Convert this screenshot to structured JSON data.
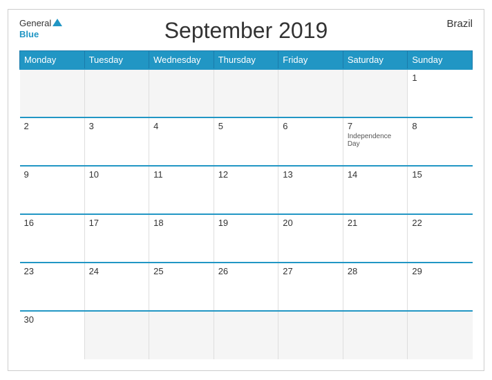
{
  "header": {
    "title": "September 2019",
    "country": "Brazil",
    "logo_general": "General",
    "logo_blue": "Blue"
  },
  "weekdays": [
    "Monday",
    "Tuesday",
    "Wednesday",
    "Thursday",
    "Friday",
    "Saturday",
    "Sunday"
  ],
  "weeks": [
    [
      {
        "day": "",
        "empty": true
      },
      {
        "day": "",
        "empty": true
      },
      {
        "day": "",
        "empty": true
      },
      {
        "day": "",
        "empty": true
      },
      {
        "day": "",
        "empty": true
      },
      {
        "day": "",
        "empty": true
      },
      {
        "day": "1",
        "empty": false
      }
    ],
    [
      {
        "day": "2",
        "empty": false
      },
      {
        "day": "3",
        "empty": false
      },
      {
        "day": "4",
        "empty": false
      },
      {
        "day": "5",
        "empty": false
      },
      {
        "day": "6",
        "empty": false
      },
      {
        "day": "7",
        "empty": false,
        "holiday": "Independence Day"
      },
      {
        "day": "8",
        "empty": false
      }
    ],
    [
      {
        "day": "9",
        "empty": false
      },
      {
        "day": "10",
        "empty": false
      },
      {
        "day": "11",
        "empty": false
      },
      {
        "day": "12",
        "empty": false
      },
      {
        "day": "13",
        "empty": false
      },
      {
        "day": "14",
        "empty": false
      },
      {
        "day": "15",
        "empty": false
      }
    ],
    [
      {
        "day": "16",
        "empty": false
      },
      {
        "day": "17",
        "empty": false
      },
      {
        "day": "18",
        "empty": false
      },
      {
        "day": "19",
        "empty": false
      },
      {
        "day": "20",
        "empty": false
      },
      {
        "day": "21",
        "empty": false
      },
      {
        "day": "22",
        "empty": false
      }
    ],
    [
      {
        "day": "23",
        "empty": false
      },
      {
        "day": "24",
        "empty": false
      },
      {
        "day": "25",
        "empty": false
      },
      {
        "day": "26",
        "empty": false
      },
      {
        "day": "27",
        "empty": false
      },
      {
        "day": "28",
        "empty": false
      },
      {
        "day": "29",
        "empty": false
      }
    ],
    [
      {
        "day": "30",
        "empty": false
      },
      {
        "day": "",
        "empty": true
      },
      {
        "day": "",
        "empty": true
      },
      {
        "day": "",
        "empty": true
      },
      {
        "day": "",
        "empty": true
      },
      {
        "day": "",
        "empty": true
      },
      {
        "day": "",
        "empty": true
      }
    ]
  ]
}
